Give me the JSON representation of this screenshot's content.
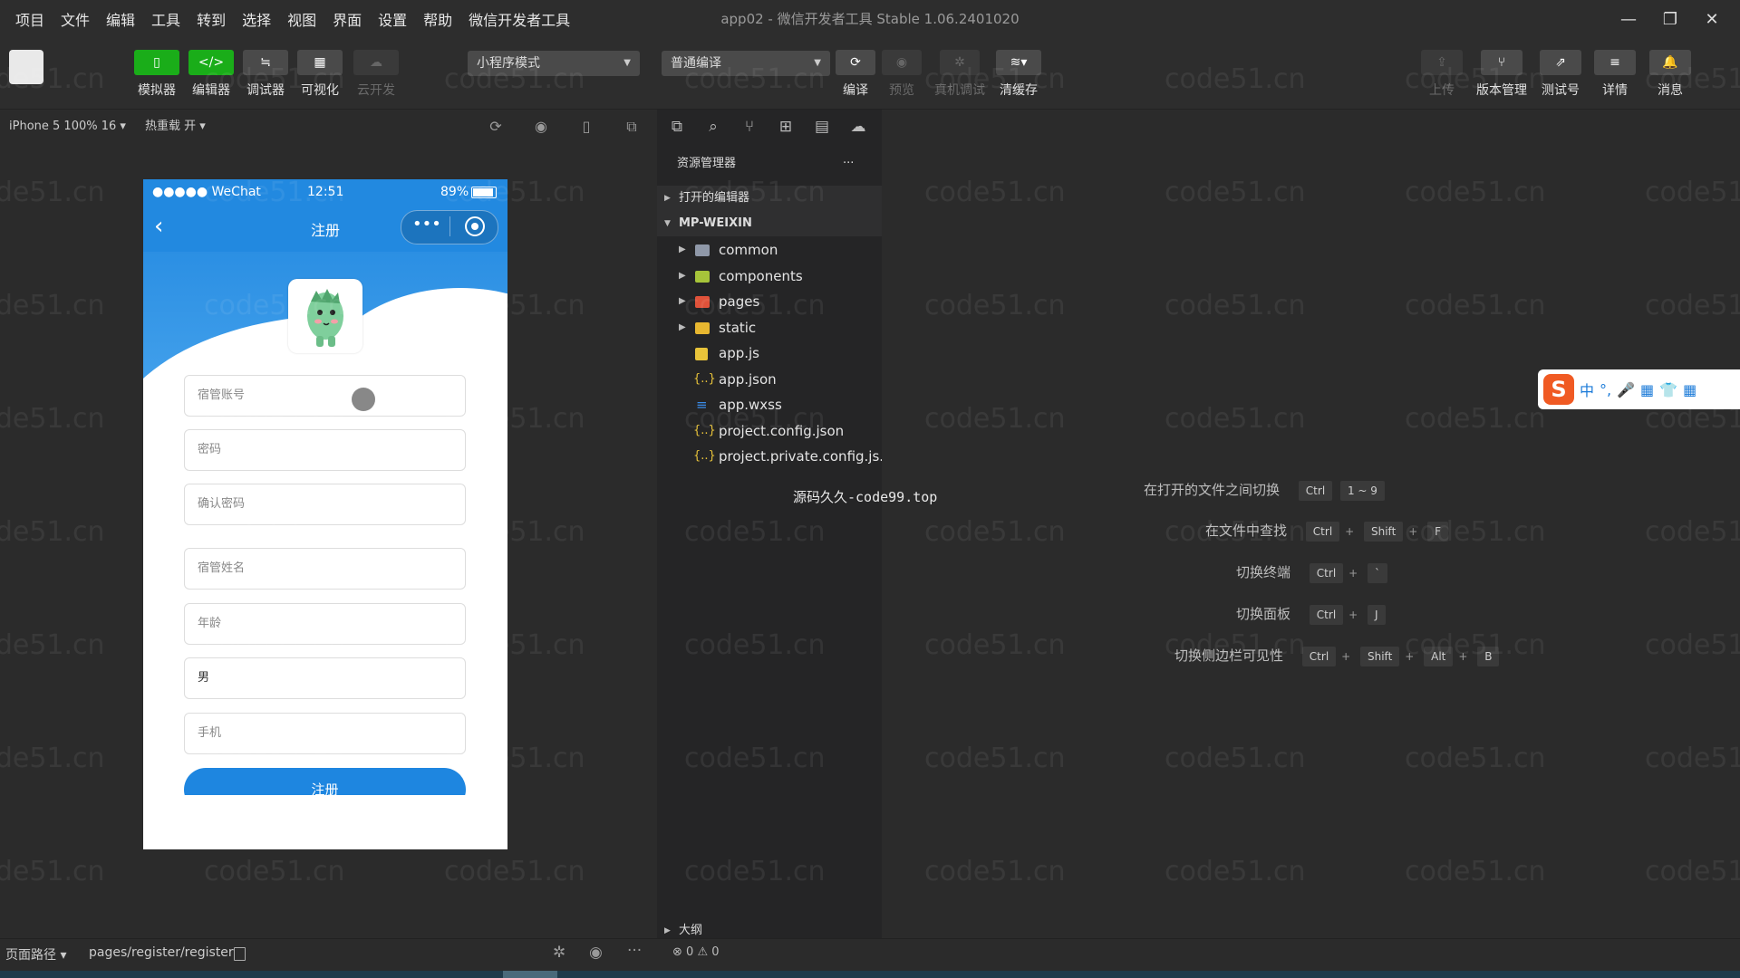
{
  "menu": [
    "项目",
    "文件",
    "编辑",
    "工具",
    "转到",
    "选择",
    "视图",
    "界面",
    "设置",
    "帮助",
    "微信开发者工具"
  ],
  "window_title": "app02 - 微信开发者工具 Stable 1.06.2401020",
  "toolbar": {
    "simulator": "模拟器",
    "editor": "编辑器",
    "debugger": "调试器",
    "visual": "可视化",
    "cloud": "云开发",
    "mode_select": "小程序模式",
    "compile_select": "普通编译",
    "compile": "编译",
    "preview": "预览",
    "real_debug": "真机调试",
    "clear_cache": "清缓存",
    "upload": "上传",
    "version": "版本管理",
    "test_account": "测试号",
    "details": "详情",
    "messages": "消息"
  },
  "subbar": {
    "device": "iPhone 5 100% 16 ▾",
    "hot_reload": "热重载 开 ▾"
  },
  "phone": {
    "carrier": "●●●●● WeChat",
    "time": "12:51",
    "battery": "89%",
    "page_title": "注册",
    "fields": [
      {
        "placeholder": "宿管账号",
        "filled": false
      },
      {
        "placeholder": "密码",
        "filled": false
      },
      {
        "placeholder": "确认密码",
        "filled": false
      },
      {
        "placeholder": "宿管姓名",
        "filled": false
      },
      {
        "placeholder": "年龄",
        "filled": false
      },
      {
        "placeholder": "男",
        "filled": true
      },
      {
        "placeholder": "手机",
        "filled": false
      }
    ],
    "register_button": "注册"
  },
  "explorer": {
    "title": "资源管理器",
    "more": "···",
    "open_editors": "打开的编辑器",
    "root": "MP-WEIXIN",
    "items": [
      {
        "name": "common",
        "kind": "folder",
        "color": "#8f98a8"
      },
      {
        "name": "components",
        "kind": "folder",
        "color": "#a7c43a"
      },
      {
        "name": "pages",
        "kind": "folder",
        "color": "#e0523a"
      },
      {
        "name": "static",
        "kind": "folder",
        "color": "#e8b730"
      },
      {
        "name": "app.js",
        "kind": "file",
        "color": "#e8c33a"
      },
      {
        "name": "app.json",
        "kind": "file",
        "color": "#e8c33a"
      },
      {
        "name": "app.wxss",
        "kind": "file",
        "color": "#3a8be8"
      },
      {
        "name": "project.config.json",
        "kind": "file",
        "color": "#e8c33a"
      },
      {
        "name": "project.private.config.js...",
        "kind": "file",
        "color": "#e8c33a"
      }
    ],
    "outline": "大纲"
  },
  "shortcuts": [
    {
      "label": "在打开的文件之间切换",
      "keys": [
        "Ctrl",
        "1 ~ 9"
      ]
    },
    {
      "label": "在文件中查找",
      "keys": [
        "Ctrl",
        "Shift",
        "F"
      ]
    },
    {
      "label": "切换终端",
      "keys": [
        "Ctrl",
        "`"
      ]
    },
    {
      "label": "切换面板",
      "keys": [
        "Ctrl",
        "J"
      ]
    },
    {
      "label": "切换侧边栏可见性",
      "keys": [
        "Ctrl",
        "Shift",
        "Alt",
        "B"
      ]
    }
  ],
  "source_text": "源码久久-code99.top",
  "watermark": "code51.cn",
  "statusbar": {
    "path_label": "页面路径 ▾",
    "path_value": "pages/register/register",
    "errors": "0",
    "warnings": "0"
  },
  "ime": {
    "logo": "S",
    "items": [
      "中",
      "°,",
      "🎤",
      "▦",
      "👕",
      "▦"
    ]
  }
}
